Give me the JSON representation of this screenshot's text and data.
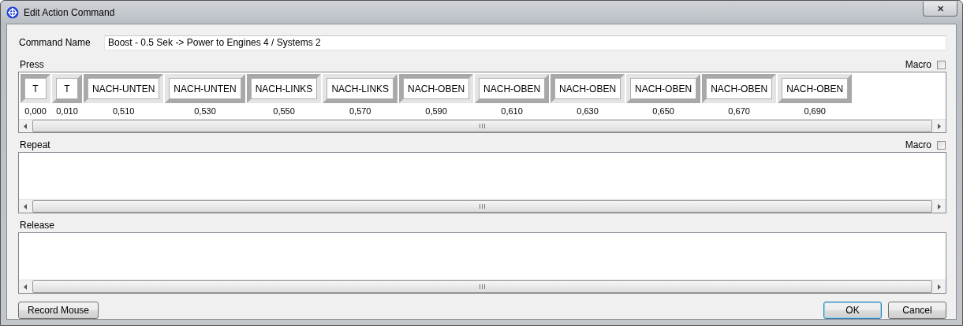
{
  "window": {
    "title": "Edit Action Command",
    "close": "✕"
  },
  "command_name": {
    "label": "Command Name",
    "value": "Boost - 0.5 Sek -> Power to Engines 4 / Systems 2"
  },
  "sections": [
    {
      "label": "Press",
      "macro": {
        "label": "Macro",
        "checked": false
      },
      "keys": [
        {
          "key": "T",
          "time": "0,000",
          "pressed": true
        },
        {
          "key": "T",
          "time": "0,010",
          "pressed": false
        },
        {
          "key": "NACH-UNTEN",
          "time": "0,510",
          "pressed": true
        },
        {
          "key": "NACH-UNTEN",
          "time": "0,530",
          "pressed": false
        },
        {
          "key": "NACH-LINKS",
          "time": "0,550",
          "pressed": true
        },
        {
          "key": "NACH-LINKS",
          "time": "0,570",
          "pressed": false
        },
        {
          "key": "NACH-OBEN",
          "time": "0,590",
          "pressed": true
        },
        {
          "key": "NACH-OBEN",
          "time": "0,610",
          "pressed": false
        },
        {
          "key": "NACH-OBEN",
          "time": "0,630",
          "pressed": true
        },
        {
          "key": "NACH-OBEN",
          "time": "0,650",
          "pressed": false
        },
        {
          "key": "NACH-OBEN",
          "time": "0,670",
          "pressed": true
        },
        {
          "key": "NACH-OBEN",
          "time": "0,690",
          "pressed": false
        }
      ]
    },
    {
      "label": "Repeat",
      "macro": {
        "label": "Macro",
        "checked": false
      }
    },
    {
      "label": "Release"
    }
  ],
  "buttons": [
    {
      "label": "Record Mouse",
      "kind": "left"
    },
    {
      "label": "OK",
      "kind": "default"
    },
    {
      "label": "Cancel",
      "kind": "normal"
    }
  ]
}
